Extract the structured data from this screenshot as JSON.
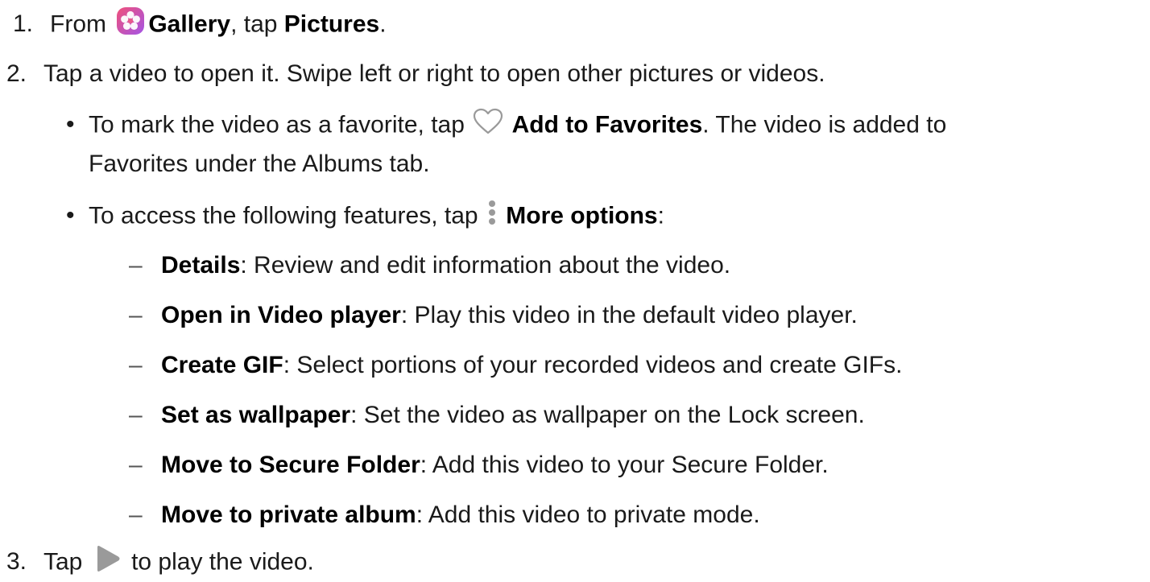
{
  "steps": {
    "s1": {
      "number": "1.",
      "prefix": "From",
      "app_name": "Gallery",
      "middle": ", tap",
      "target": "Pictures",
      "end": "."
    },
    "s2": {
      "number": "2.",
      "text": "Tap a video to open it. Swipe left or right to open other pictures or videos.",
      "bullets": {
        "b1": {
          "marker": "•",
          "prefix": "To mark the video as a favorite, tap",
          "bold": "Add to Favorites",
          "suffix": ". The video is added to",
          "continuation": "Favorites under the Albums tab."
        },
        "b2": {
          "marker": "•",
          "prefix": "To access the following features, tap",
          "bold": "More options",
          "suffix": ":"
        }
      },
      "options": [
        {
          "marker": "–",
          "name": "Details",
          "desc": ": Review and edit information about the video."
        },
        {
          "marker": "–",
          "name": "Open in Video player",
          "desc": ": Play this video in the default video player."
        },
        {
          "marker": "–",
          "name": "Create GIF",
          "desc": ": Select portions of your recorded videos and create GIFs."
        },
        {
          "marker": "–",
          "name": "Set as wallpaper",
          "desc": ": Set the video as wallpaper on the Lock screen."
        },
        {
          "marker": "–",
          "name": "Move to Secure Folder",
          "desc": ": Add this video to your Secure Folder."
        },
        {
          "marker": "–",
          "name": "Move to private album",
          "desc": ": Add this video to private mode."
        }
      ]
    },
    "s3": {
      "number": "3.",
      "prefix": "Tap",
      "suffix": "to play the video."
    }
  },
  "icons": {
    "gallery": "gallery-app-icon",
    "heart": "heart-outline-icon",
    "more": "more-options-icon",
    "play": "play-icon"
  },
  "colors": {
    "gallery_gradient_start": "#f0507a",
    "gallery_gradient_end": "#a455e6",
    "icon_gray": "#9a9a9a"
  }
}
